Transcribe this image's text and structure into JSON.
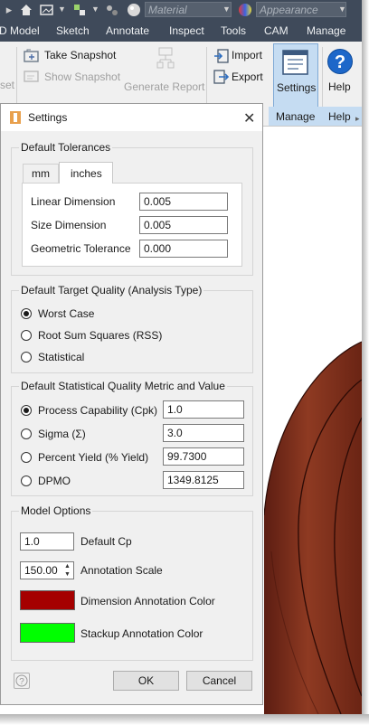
{
  "toolbar": {
    "material_placeholder": "Material",
    "appearance_placeholder": "Appearance"
  },
  "tabs": [
    "D Model",
    "Sketch",
    "Annotate",
    "Inspect",
    "Tools",
    "CAM",
    "Manage"
  ],
  "ribbon": {
    "left_cut_label": "set",
    "take_snapshot": "Take Snapshot",
    "show_snapshot": "Show Snapshot",
    "generate_report": "Generate Report",
    "import": "Import",
    "export": "Export",
    "settings": "Settings",
    "help": "Help",
    "panel_manage": "Manage",
    "panel_help": "Help"
  },
  "dialog": {
    "title": "Settings",
    "tolerances": {
      "group_label": "Default Tolerances",
      "tabs": [
        "mm",
        "inches"
      ],
      "active_tab": "inches",
      "rows": [
        {
          "label": "Linear Dimension",
          "value": "0.005"
        },
        {
          "label": "Size Dimension",
          "value": "0.005"
        },
        {
          "label": "Geometric Tolerance",
          "value": "0.000"
        }
      ]
    },
    "target_quality": {
      "group_label": "Default Target Quality (Analysis Type)",
      "options": [
        {
          "label": "Worst Case",
          "selected": true
        },
        {
          "label": "Root Sum Squares (RSS)",
          "selected": false
        },
        {
          "label": "Statistical",
          "selected": false
        }
      ]
    },
    "statistical_metric": {
      "group_label": "Default Statistical Quality Metric and Value",
      "options": [
        {
          "label": "Process Capability (Cpk)",
          "value": "1.0",
          "selected": true
        },
        {
          "label": "Sigma (Σ)",
          "value": "3.0",
          "selected": false
        },
        {
          "label": "Percent Yield (% Yield)",
          "value": "99.7300",
          "selected": false
        },
        {
          "label": "DPMO",
          "value": "1349.8125",
          "selected": false
        }
      ]
    },
    "model_options": {
      "group_label": "Model Options",
      "default_cp_value": "1.0",
      "default_cp_label": "Default Cp",
      "annotation_scale_value": "150.00",
      "annotation_scale_label": "Annotation Scale",
      "dimension_color": "#a50000",
      "dimension_color_label": "Dimension Annotation Color",
      "stackup_color": "#00ff00",
      "stackup_color_label": "Stackup Annotation Color"
    },
    "ok_label": "OK",
    "cancel_label": "Cancel"
  },
  "colors": {
    "ribbon_dark": "#3f4a5a",
    "settings_active": "#c5dcf2",
    "model_brown": "#7a2b1c",
    "inventor_orange": "#e8a04d"
  }
}
